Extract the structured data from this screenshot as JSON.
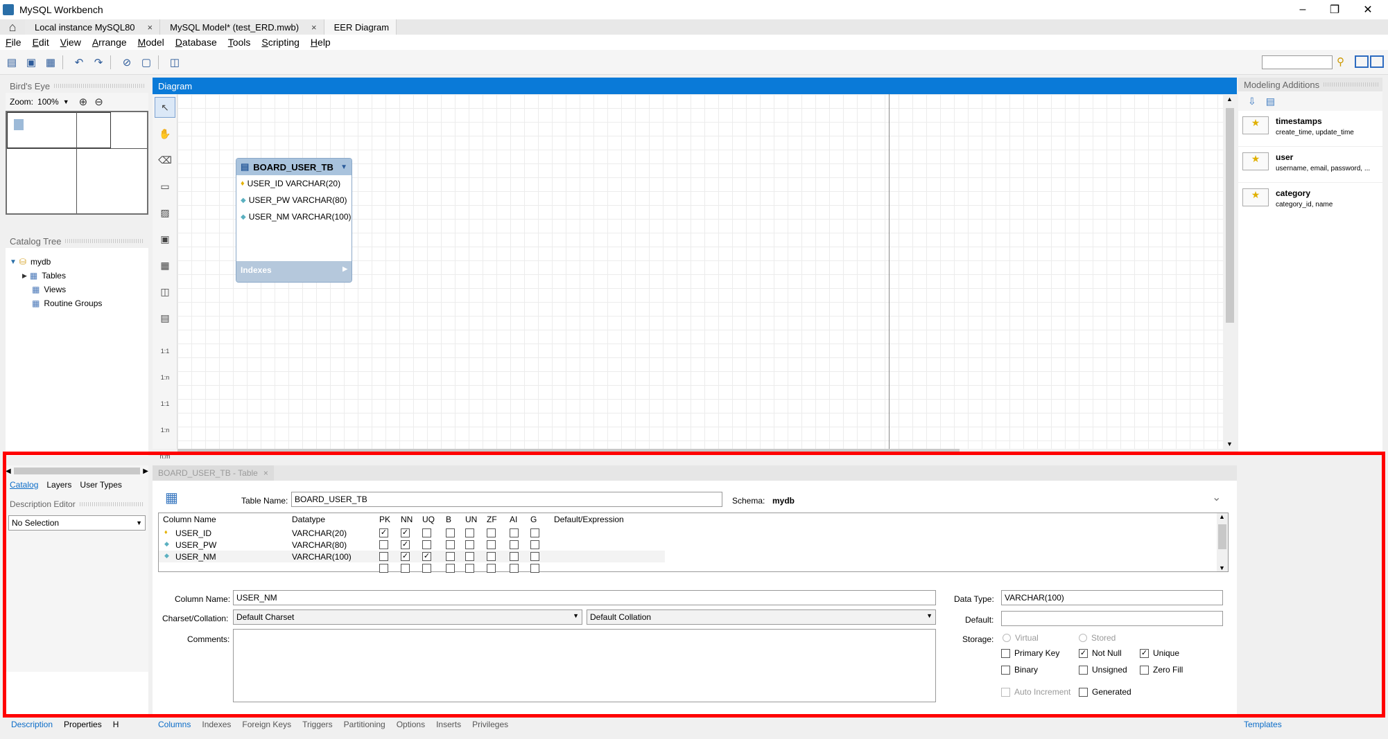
{
  "window": {
    "title": "MySQL Workbench",
    "minimize": "–",
    "restore": "❐",
    "close": "✕"
  },
  "tabs": [
    {
      "label": "Local instance MySQL80",
      "close": "×"
    },
    {
      "label": "MySQL Model* (test_ERD.mwb)",
      "close": "×"
    },
    {
      "label": "EER Diagram",
      "close": ""
    }
  ],
  "menu": [
    {
      "prefix": "",
      "u": "F",
      "rest": "ile"
    },
    {
      "prefix": "",
      "u": "E",
      "rest": "dit"
    },
    {
      "prefix": "",
      "u": "V",
      "rest": "iew"
    },
    {
      "prefix": "",
      "u": "A",
      "rest": "rrange"
    },
    {
      "prefix": "",
      "u": "M",
      "rest": "odel"
    },
    {
      "prefix": "",
      "u": "D",
      "rest": "atabase"
    },
    {
      "prefix": "",
      "u": "T",
      "rest": "ools"
    },
    {
      "prefix": "",
      "u": "S",
      "rest": "cripting"
    },
    {
      "prefix": "",
      "u": "H",
      "rest": "elp"
    }
  ],
  "birds_eye": {
    "title": "Bird's Eye",
    "zoom_label": "Zoom:",
    "zoom_value": "100%"
  },
  "catalog_tree": {
    "title": "Catalog Tree",
    "root": "mydb",
    "children": [
      "Tables",
      "Views",
      "Routine Groups"
    ]
  },
  "diagram": {
    "title": "Diagram",
    "table": {
      "name": "BOARD_USER_TB",
      "columns": [
        "USER_ID VARCHAR(20)",
        "USER_PW VARCHAR(80)",
        "USER_NM VARCHAR(100)"
      ],
      "indexes_label": "Indexes"
    },
    "palette_labels": [
      "1:1",
      "1:n",
      "1:1",
      "1:n",
      "n:m"
    ]
  },
  "modeling_additions": {
    "title": "Modeling Additions",
    "items": [
      {
        "name": "timestamps",
        "desc": "create_time, update_time"
      },
      {
        "name": "user",
        "desc": "username, email, password, ..."
      },
      {
        "name": "category",
        "desc": "category_id, name"
      }
    ],
    "templates_tab": "Templates"
  },
  "left_lower": {
    "tabs": [
      "Catalog",
      "Layers",
      "User Types"
    ],
    "desc_editor": "Description Editor",
    "selection": "No Selection",
    "bottom_tabs": [
      "Description",
      "Properties",
      "H"
    ]
  },
  "editor": {
    "tab_label": "BOARD_USER_TB - Table",
    "table_name_label": "Table Name:",
    "table_name": "BOARD_USER_TB",
    "schema_label": "Schema:",
    "schema": "mydb",
    "grid_headers": [
      "Column Name",
      "Datatype",
      "PK",
      "NN",
      "UQ",
      "B",
      "UN",
      "ZF",
      "AI",
      "G",
      "Default/Expression"
    ],
    "rows": [
      {
        "name": "USER_ID",
        "type": "VARCHAR(20)",
        "flags": [
          true,
          true,
          false,
          false,
          false,
          false,
          false,
          false
        ]
      },
      {
        "name": "USER_PW",
        "type": "VARCHAR(80)",
        "flags": [
          false,
          true,
          false,
          false,
          false,
          false,
          false,
          false
        ]
      },
      {
        "name": "USER_NM",
        "type": "VARCHAR(100)",
        "flags": [
          false,
          true,
          true,
          false,
          false,
          false,
          false,
          false
        ]
      }
    ],
    "column_name_label": "Column Name:",
    "column_name": "USER_NM",
    "charset_label": "Charset/Collation:",
    "charset": "Default Charset",
    "collation": "Default Collation",
    "comments_label": "Comments:",
    "data_type_label": "Data Type:",
    "data_type": "VARCHAR(100)",
    "default_label": "Default:",
    "storage_label": "Storage:",
    "virtual": "Virtual",
    "stored": "Stored",
    "primary_key": "Primary Key",
    "not_null": "Not Null",
    "unique": "Unique",
    "binary": "Binary",
    "unsigned": "Unsigned",
    "zero_fill": "Zero Fill",
    "auto_increment": "Auto Increment",
    "generated": "Generated",
    "bottom_tabs": [
      "Columns",
      "Indexes",
      "Foreign Keys",
      "Triggers",
      "Partitioning",
      "Options",
      "Inserts",
      "Privileges"
    ]
  },
  "colors": {
    "accent": "#0a7ad8",
    "highlight": "#ff0000"
  }
}
